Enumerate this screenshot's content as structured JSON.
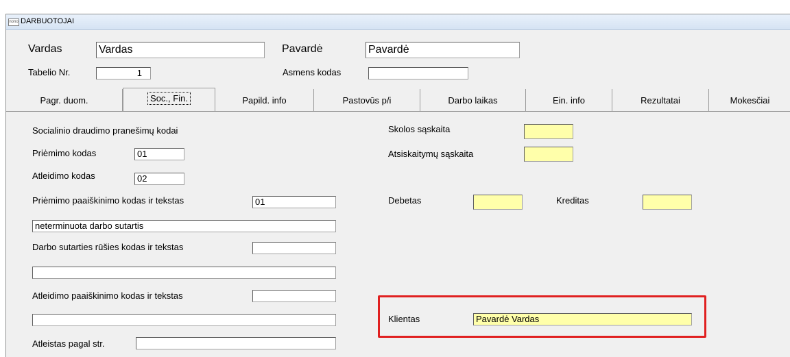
{
  "window": {
    "icon_text": "nono",
    "title": "DARBUOTOJAI"
  },
  "header": {
    "vardas_label": "Vardas",
    "vardas_value": "Vardas",
    "pavarde_label": "Pavardė",
    "pavarde_value": "Pavardė",
    "tabelio_label": "Tabelio Nr.",
    "tabelio_value": "1",
    "asmens_label": "Asmens kodas",
    "asmens_value": ""
  },
  "tabs": [
    {
      "label": "Pagr. duom."
    },
    {
      "label": "Soc., Fin."
    },
    {
      "label": "Papild. info"
    },
    {
      "label": "Pastovūs p/i"
    },
    {
      "label": "Darbo laikas"
    },
    {
      "label": "Ein. info"
    },
    {
      "label": "Rezultatai"
    },
    {
      "label": "Mokesčiai"
    }
  ],
  "form": {
    "soc_heading": "Socialinio draudimo pranešimų kodai",
    "priemimo_label": "Priėmimo kodas",
    "priemimo_value": "01",
    "atleidimo_label": "Atleidimo kodas",
    "atleidimo_value": "02",
    "priemimo_paaisk_label": "Priėmimo paaiškinimo kodas ir tekstas",
    "priemimo_paaisk_code": "01",
    "priemimo_paaisk_text": "neterminuota darbo sutartis",
    "sutarties_label": "Darbo sutarties rūšies kodas ir tekstas",
    "sutarties_code": "",
    "sutarties_text": "",
    "atleidimo_paaisk_label": "Atleidimo paaiškinimo kodas ir tekstas",
    "atleidimo_paaisk_code": "",
    "atleidimo_paaisk_text": "",
    "atleistas_label": "Atleistas pagal str.",
    "atleistas_value": "",
    "skolos_label": "Skolos sąskaita",
    "skolos_value": "",
    "atsiskaitymu_label": "Atsiskaitymų sąskaita",
    "atsiskaitymu_value": "",
    "debetas_label": "Debetas",
    "debetas_value": "",
    "kreditas_label": "Kreditas",
    "kreditas_value": "",
    "klientas_label": "Klientas",
    "klientas_value": "Pavardė Vardas"
  },
  "colors": {
    "highlight": "#e02020",
    "yellow_field": "#ffffaa",
    "window_bg": "#f0f0f0"
  }
}
